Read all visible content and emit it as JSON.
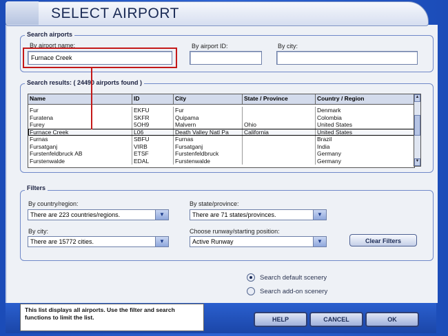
{
  "window": {
    "title": "SELECT AIRPORT"
  },
  "search": {
    "group_label": "Search airports",
    "name_label": "By airport name:",
    "name_value": "Furnace Creek",
    "id_label": "By airport ID:",
    "id_value": "",
    "city_label": "By city:",
    "city_value": ""
  },
  "results": {
    "group_label": "Search results: ( 24490 airports found )",
    "columns": [
      "Name",
      "ID",
      "City",
      "State / Province",
      "Country / Region"
    ],
    "rows": [
      [
        "Fur",
        "EKFU",
        "Fur",
        "",
        "Denmark"
      ],
      [
        "Furatena",
        "SKFR",
        "Quipama",
        "",
        "Colombia"
      ],
      [
        "Furey",
        "5OH9",
        "Malvern",
        "Ohio",
        "United States"
      ],
      [
        "Furnace Creek",
        "L06",
        "Death Valley Natl Pa",
        "California",
        "United States"
      ],
      [
        "Furnas",
        "SBFU",
        "Furnas",
        "",
        "Brazil"
      ],
      [
        "Fursatganj",
        "VIRB",
        "Fursatganj",
        "",
        "India"
      ],
      [
        "Furstenfeldbruck AB",
        "ETSF",
        "Furstenfeldbruck",
        "",
        "Germany"
      ],
      [
        "Furstenwalde",
        "EDAL",
        "Furstenwalde",
        "",
        "Germany"
      ]
    ],
    "selected_index": 3
  },
  "filters": {
    "group_label": "Filters",
    "country_label": "By country/region:",
    "country_value": "There are 223 countries/regions.",
    "state_label": "By state/province:",
    "state_value": "There are 71 states/provinces.",
    "city_label": "By city:",
    "city_value": "There are 15772 cities.",
    "runway_label": "Choose runway/starting position:",
    "runway_value": "Active Runway",
    "clear_button": "Clear Filters"
  },
  "scenery": {
    "default_label": "Search default scenery",
    "addon_label": "Search add-on scenery",
    "selected": "default"
  },
  "footer": {
    "hint": "This list displays all airports. Use the filter and search functions to limit the list.",
    "help_button": "HELP",
    "cancel_button": "CANCEL",
    "ok_button": "OK"
  },
  "colors": {
    "highlight": "#c41818",
    "chrome": "#1b4cb8"
  }
}
